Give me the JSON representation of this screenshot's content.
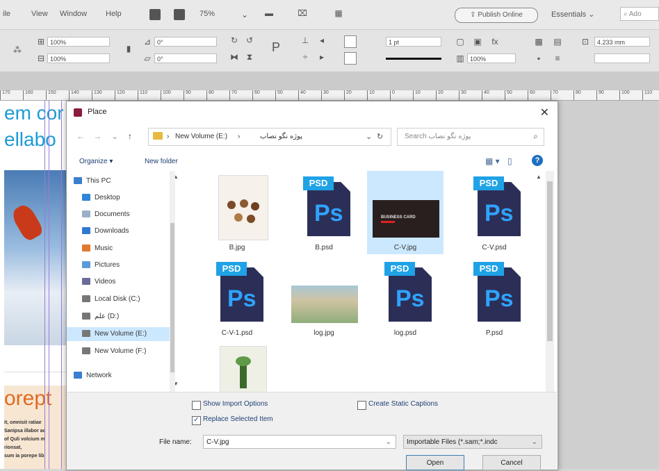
{
  "menubar": {
    "items": [
      "ile",
      "View",
      "Window",
      "Help"
    ],
    "zoom": "75%",
    "publish_label": "Publish Online",
    "workspace": "Essentials",
    "search_placeholder": "Ado"
  },
  "controlbar": {
    "scale_x": "100%",
    "scale_y": "100%",
    "angle": "0°",
    "shear": "0°",
    "stroke_weight": "1 pt",
    "dimension": "4.233 mm",
    "opacity": "100%"
  },
  "ruler": {
    "ticks": [
      "170",
      "160",
      "150",
      "140",
      "130",
      "120",
      "110",
      "100",
      "90",
      "80",
      "70",
      "60",
      "50",
      "40",
      "30",
      "20",
      "10",
      "0",
      "10",
      "20",
      "30",
      "40",
      "50",
      "60",
      "70",
      "80",
      "90",
      "100",
      "110"
    ]
  },
  "document": {
    "title_line1": "em cor",
    "title_line2": "ellabo",
    "heading": "orept",
    "body_lines": [
      "it, omnisit ratiae",
      "Sanipsa illabor ac",
      "of Quli volcium m",
      "rionsat,",
      "sum ia porepe lib"
    ]
  },
  "dialog": {
    "title": "Place",
    "address": {
      "volume": "New Volume (E:)",
      "folder": "پوژه نگو نصاب"
    },
    "search_placeholder": "Search پوژه نگو نصاب",
    "organize_label": "Organize ▾",
    "new_folder_label": "New folder",
    "nav_items": [
      {
        "label": "This PC",
        "icon": "pc-icon"
      },
      {
        "label": "Desktop",
        "icon": "desktop-icon"
      },
      {
        "label": "Documents",
        "icon": "documents-icon"
      },
      {
        "label": "Downloads",
        "icon": "downloads-icon"
      },
      {
        "label": "Music",
        "icon": "music-icon"
      },
      {
        "label": "Pictures",
        "icon": "pictures-icon"
      },
      {
        "label": "Videos",
        "icon": "videos-icon"
      },
      {
        "label": "Local Disk (C:)",
        "icon": "drive-icon"
      },
      {
        "label": "علم (D:)",
        "icon": "drive-icon"
      },
      {
        "label": "New Volume (E:)",
        "icon": "drive-icon"
      },
      {
        "label": "New Volume (F:)",
        "icon": "drive-icon"
      },
      {
        "label": "Network",
        "icon": "network-icon"
      }
    ],
    "files": [
      {
        "name": "B.jpg",
        "kind": "image"
      },
      {
        "name": "B.psd",
        "kind": "psd"
      },
      {
        "name": "C-V.jpg",
        "kind": "image"
      },
      {
        "name": "C-V.psd",
        "kind": "psd"
      },
      {
        "name": "C-V-1.psd",
        "kind": "psd"
      },
      {
        "name": "log.jpg",
        "kind": "image"
      },
      {
        "name": "log.psd",
        "kind": "psd"
      },
      {
        "name": "P.psd",
        "kind": "psd"
      },
      {
        "name": "",
        "kind": "image"
      }
    ],
    "psd_badge": "PSD",
    "psd_letters": "Ps",
    "thumb_text": "BUSINESS CARD",
    "show_import_options": "Show Import Options",
    "create_static_captions": "Create Static Captions",
    "replace_selected_item": "Replace Selected Item",
    "file_name_label": "File name:",
    "file_name_value": "C-V.jpg",
    "file_type": "Importable Files (*.sam;*.indc",
    "open_label": "Open",
    "cancel_label": "Cancel"
  }
}
